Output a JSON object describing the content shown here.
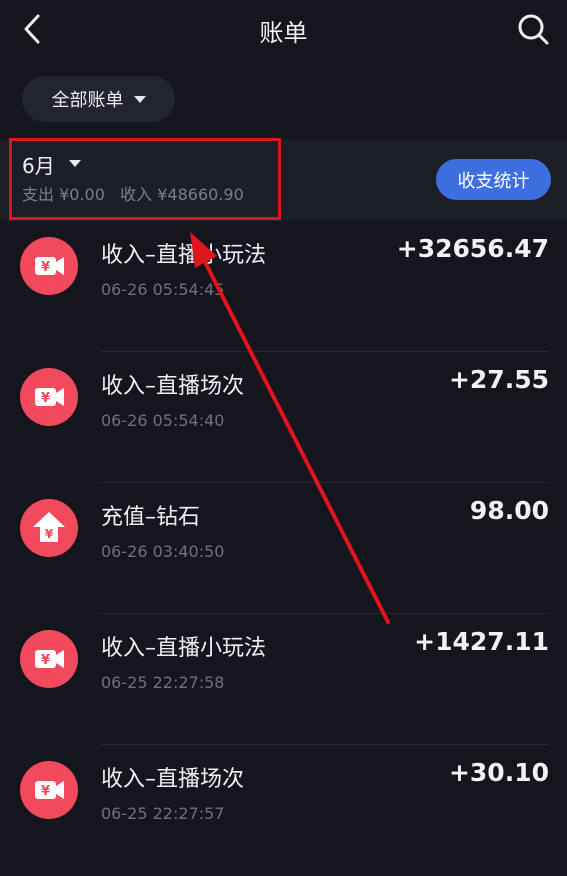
{
  "header": {
    "title": "账单"
  },
  "filter": {
    "label": "全部账单"
  },
  "month": {
    "label": "6月",
    "summary": "支出 ¥0.00   收入 ¥48660.90",
    "stats_button": "收支统计"
  },
  "transactions": [
    {
      "title": "收入–直播小玩法",
      "time": "06-26 05:54:45",
      "amount": "+32656.47",
      "icon": "yen-video-icon"
    },
    {
      "title": "收入–直播场次",
      "time": "06-26 05:54:40",
      "amount": "+27.55",
      "icon": "yen-video-icon"
    },
    {
      "title": "充值–钻石",
      "time": "06-26 03:40:50",
      "amount": "98.00",
      "icon": "yen-up-arrow-icon"
    },
    {
      "title": "收入–直播小玩法",
      "time": "06-25 22:27:58",
      "amount": "+1427.11",
      "icon": "yen-video-icon"
    },
    {
      "title": "收入–直播场次",
      "time": "06-25 22:27:57",
      "amount": "+30.10",
      "icon": "yen-video-icon"
    }
  ],
  "colors": {
    "background": "#15161d",
    "accent": "#3e6fe0",
    "icon": "#f04a5c",
    "highlight": "#e0141c"
  }
}
